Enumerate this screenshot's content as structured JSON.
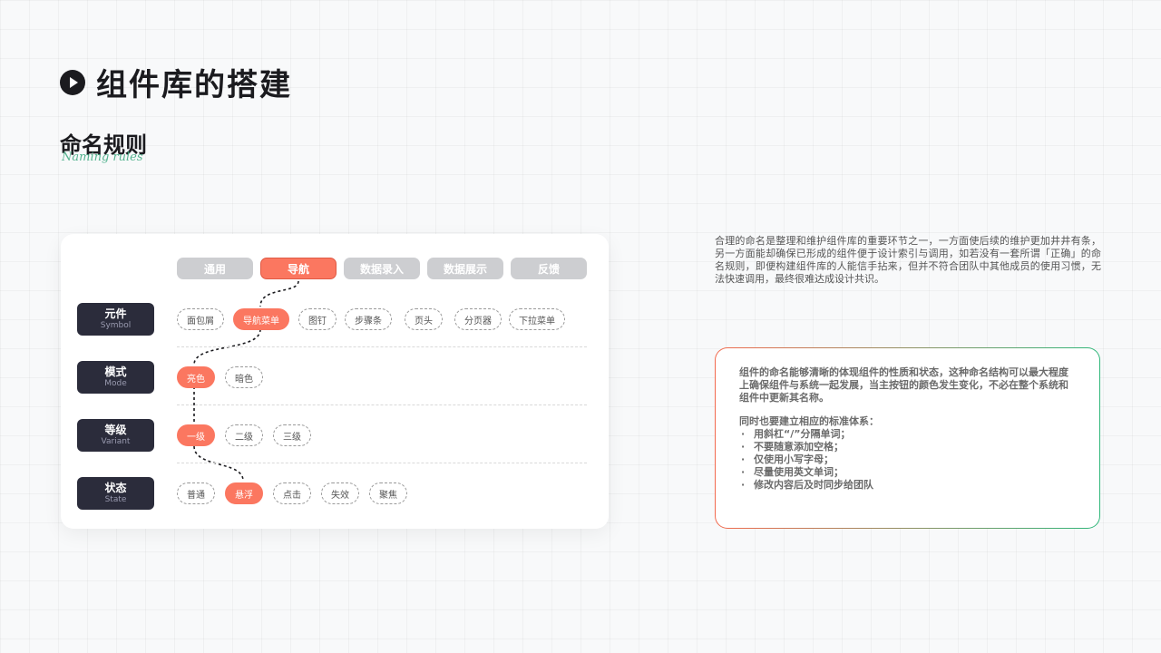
{
  "header": {
    "title": "组件库的搭建"
  },
  "section": {
    "title": "命名规则",
    "subtitle": "Naming rules"
  },
  "tabs": [
    "通用",
    "导航",
    "数据录入",
    "数据展示",
    "反馈"
  ],
  "active_tab": 1,
  "rows": [
    {
      "cn": "元件",
      "en": "Symbol",
      "items": [
        "面包屑",
        "导航菜单",
        "图钉",
        "步骤条",
        "页头",
        "分页器",
        "下拉菜单"
      ],
      "active": 1
    },
    {
      "cn": "模式",
      "en": "Mode",
      "items": [
        "亮色",
        "暗色"
      ],
      "active": 0
    },
    {
      "cn": "等级",
      "en": "Variant",
      "items": [
        "一级",
        "二级",
        "三级"
      ],
      "active": 0
    },
    {
      "cn": "状态",
      "en": "State",
      "items": [
        "普通",
        "悬浮",
        "点击",
        "失效",
        "聚焦"
      ],
      "active": 1
    }
  ],
  "paragraph": "合理的命名是整理和维护组件库的重要环节之一，一方面使后续的维护更加井井有条，另一方面能却确保已形成的组件便于设计索引与调用，如若没有一套所谓「正确」的命名规则，即便构建组件库的人能信手拈来，但并不符合团队中其他成员的使用习惯，无法快速调用，最终很难达成设计共识。",
  "info": {
    "intro": "组件的命名能够清晰的体现组件的性质和状态，这种命名结构可以最大程度上确保组件与系统一起发展，当主按钮的颜色发生变化，不必在整个系统和组件中更新其名称。",
    "list_title": "同时也要建立相应的标准体系：",
    "rules": [
      "用斜杠“/”分隔单词；",
      "不要随意添加空格；",
      "仅使用小写字母；",
      "尽量使用英文单词；",
      "修改内容后及时同步给团队"
    ]
  },
  "colors": {
    "accent": "#fb7760",
    "dark": "#2b2c3b",
    "tab_inactive": "#cdced1",
    "gradient_start": "#f36a4e",
    "gradient_end": "#2fb77a"
  }
}
